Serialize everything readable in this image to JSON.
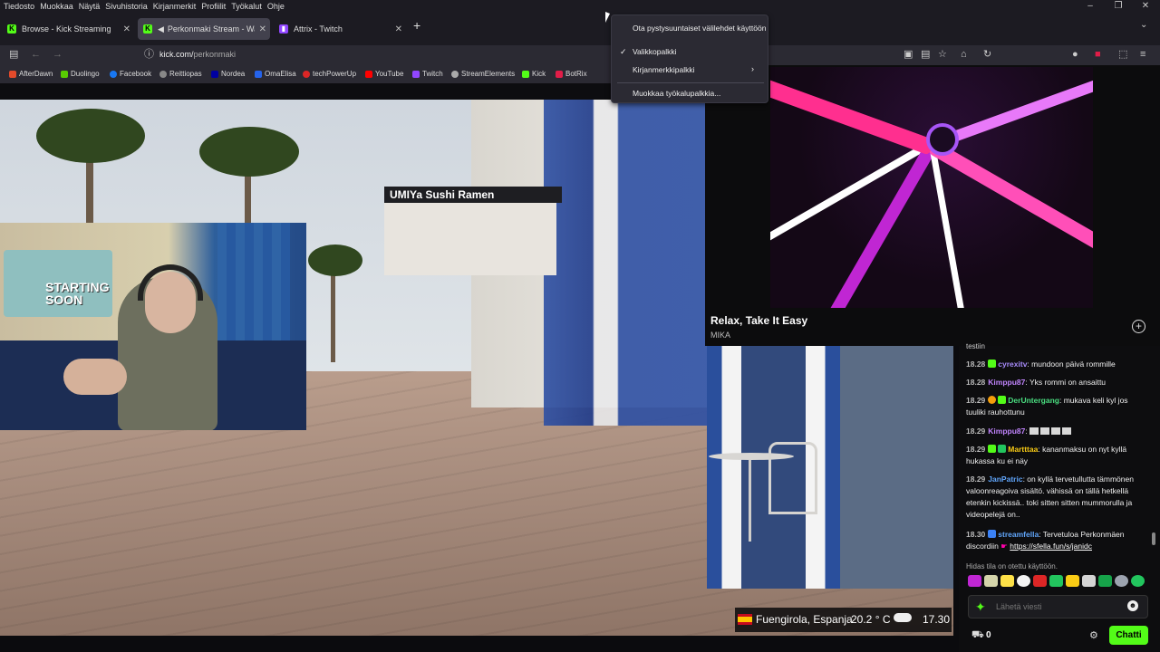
{
  "menubar": {
    "items": [
      "Tiedosto",
      "Muokkaa",
      "Näytä",
      "Sivuhistoria",
      "Kirjanmerkit",
      "Profiilit",
      "Työkalut",
      "Ohje"
    ]
  },
  "tabs": [
    {
      "label": "Browse - Kick Streaming",
      "icon": "kick-icon"
    },
    {
      "label": "Perkonmaki Stream - Watch",
      "icon": "kick-icon"
    },
    {
      "label": "Attrix - Twitch",
      "icon": "twitch-icon"
    }
  ],
  "url": {
    "domain": "kick.com/",
    "path": "perkonmaki"
  },
  "bookmarks": [
    "AfterDawn",
    "Duolingo",
    "Facebook",
    "Reittiopas",
    "Nordea",
    "OmaElisa",
    "techPowerUp",
    "YouTube",
    "Twitch",
    "StreamElements",
    "Kick",
    "BotRix"
  ],
  "context_menu": {
    "items": [
      {
        "label": "Ota pystysuuntaiset välilehdet käyttöön",
        "checked": false
      },
      {
        "label": "Valikkopalkki",
        "checked": true
      },
      {
        "label": "Kirjanmerkkipalkki",
        "checked": false,
        "submenu": true
      },
      {
        "label": "Muokkaa työkalupalkkia...",
        "checked": false
      }
    ]
  },
  "video": {
    "sign_text": "UMIYa   Sushi Ramen",
    "webcam_text": "STARTING SOON"
  },
  "music": {
    "title": "Relax, Take It Easy",
    "artist": "MIKA"
  },
  "chat": {
    "partial": "testiin",
    "messages": [
      {
        "time": "18.28",
        "user": "cyrexitv",
        "text": ": mundoon päivä rommille",
        "color": "#a78bfa"
      },
      {
        "time": "18.28",
        "user": "Kimppu87",
        "text": ": Yks rommi on ansaittu",
        "color": "#c084fc"
      },
      {
        "time": "18.29",
        "user": "DerUntergang",
        "text": ": mukava keli kyl jos tuuliki rauhottunu",
        "color": "#4ade80"
      },
      {
        "time": "18.29",
        "user": "Kimppu87",
        "text": ": ",
        "color": "#c084fc"
      },
      {
        "time": "18.29",
        "user": "Martttaa",
        "text": ": kananmaksu on nyt kyllä hukassa ku ei näy",
        "color": "#facc15"
      },
      {
        "time": "18.29",
        "user": "JanPatric",
        "text": ": on kyllä tervetullutta tämmönen valoonreagoiva sisältö. vähissä on tällä hetkellä etenkin kickissä.. toki sitten sitten mummorulla ja videopelejä on..",
        "color": "#60a5fa"
      },
      {
        "time": "18.30",
        "user": "streamfella",
        "text": ": Tervetuloa Perkonmäen discordiin",
        "color": "#60a5fa",
        "link": "https://sfella.fun/s/janidc"
      }
    ],
    "slow_mode": "Hidas tila on otettu käyttöön.",
    "input_placeholder": "Lähetä viesti",
    "gift_count": "0",
    "send_label": "Chatti"
  },
  "weather": {
    "location": "Fuengirola, Espanja",
    "temp": "20.2 ° C",
    "time": "17.30"
  },
  "colors": {
    "kick_green": "#53fc18",
    "browser_chrome": "#1c1b22",
    "toolbar": "#2b2a33"
  }
}
